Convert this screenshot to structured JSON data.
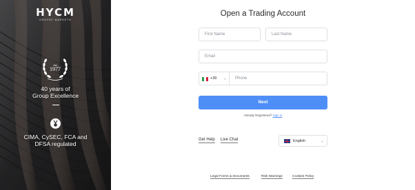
{
  "brand": {
    "logo": "HYCM",
    "tagline": "HENYEP MARKETS"
  },
  "hero": {
    "est_label": "est",
    "est_year": "1977",
    "headline_1": "40 years of",
    "headline_2": "Group Excellence",
    "regulation_1": "CIMA, CySEC, FCA and",
    "regulation_2": "DFSA regulated"
  },
  "form": {
    "title": "Open a Trading Account",
    "first_name_placeholder": "First Name",
    "last_name_placeholder": "Last Name",
    "email_placeholder": "Email",
    "phone_code": "+39",
    "phone_placeholder": "Phone",
    "next_label": "Next",
    "already_registered": "Already Registered?",
    "sign_in_label": "Sign in"
  },
  "help": {
    "get_help": "Get Help",
    "live_chat": "Live Chat"
  },
  "language": {
    "selected": "English"
  },
  "footer": {
    "legal": "Legal Forms & Documents",
    "risk": "Risk Warnings",
    "cookies": "Cookies Policy"
  },
  "colors": {
    "primary": "#4e8ef7",
    "hero_bg": "#3a3a3c"
  },
  "icons": {
    "phone_flag": "italy-flag-icon",
    "language_flag": "uk-flag-icon",
    "chevron": "chevron-down-icon",
    "medal": "medal-icon"
  }
}
